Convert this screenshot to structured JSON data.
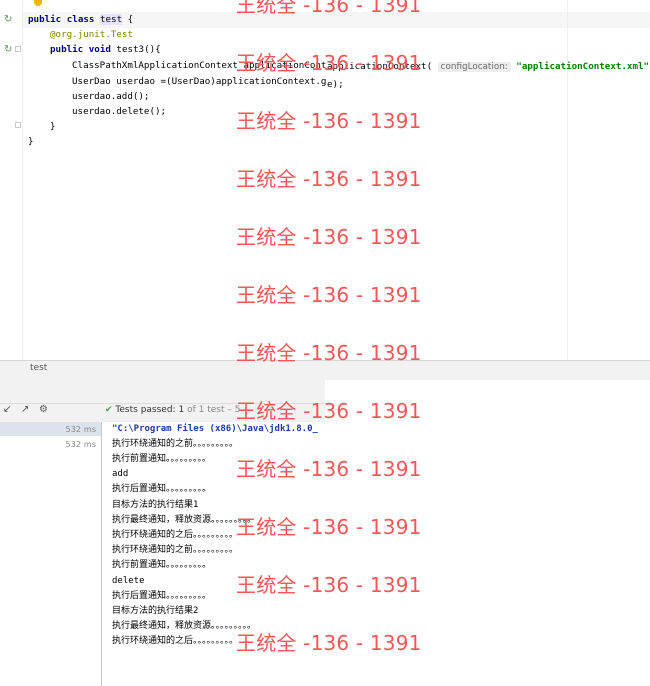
{
  "colors": {
    "keyword": "#000080",
    "annotation": "#808000",
    "string": "#008000",
    "watermark": "#f35757",
    "pass": "#4aa34a"
  },
  "icons": {
    "gutter_run": "run-test-icon",
    "gutter_fold": "fold-icon",
    "rerun": "rerun-icon",
    "export": "export-icon",
    "settings": "gear-icon",
    "check": "check-icon",
    "bulb": "intention-bulb-icon"
  },
  "editor": {
    "class_line": {
      "kw1": "public",
      "kw2": "class",
      "name": "test",
      "brace": " {"
    },
    "annotation": "@org.junit.",
    "annotation_test": "Test",
    "method_line": {
      "kw1": "public",
      "kw2": "void",
      "rest": " test3(){"
    },
    "line_context": "ClassPathXmlApplicationContext applicationCont",
    "overlap_text": "applicationContext(",
    "hint": "configLocation:",
    "config_string": "\"applicationContext.xml\");",
    "line_userdao": "UserDao userdao =(UserDao)applicationContext.g",
    "line_userdao_tail": "e);",
    "line_add": "userdao.add();",
    "line_delete": "userdao.delete();",
    "close_method": "}",
    "close_class": "}"
  },
  "run": {
    "tab_label": "test",
    "status_label": "Tests passed:",
    "status_count": "1",
    "status_of": "of 1 test – 5",
    "tree_times": [
      "532 ms",
      "532 ms"
    ],
    "console_cmd": "\"C:\\Program Files (x86)\\Java\\jdk1.8.0_",
    "console_lines": [
      "执行环绕通知的之前。。。。。。。。。",
      "执行前置通知。。。。。。。。。",
      "add",
      "执行后置通知。。。。。。。。。",
      "目标方法的执行结果1",
      "执行最终通知，释放资源。。。。。。。。。",
      "执行环绕通知的之后。。。。。。。。。",
      "执行环绕通知的之前。。。。。。。。。",
      "执行前置通知。。。。。。。。。",
      "delete",
      "执行后置通知。。。。。。。。。",
      "目标方法的执行结果2",
      "执行最终通知，释放资源。。。。。。。。。",
      "执行环绕通知的之后。。。。。。。。。"
    ]
  },
  "watermark": {
    "text": "王统全 -136 - 1391"
  }
}
